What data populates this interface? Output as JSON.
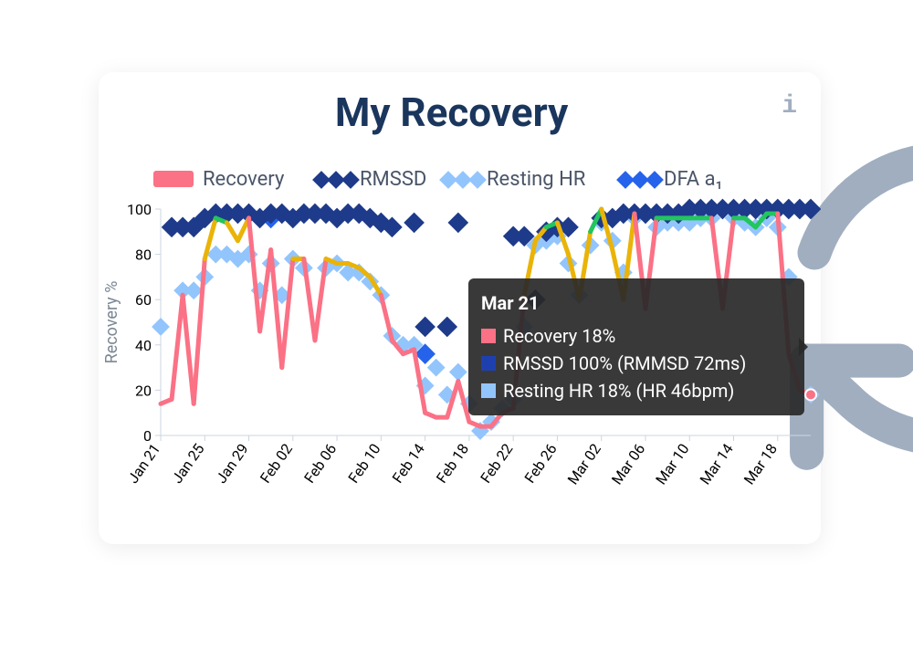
{
  "header": {
    "title": "My Recovery",
    "refresh_icon": "refresh-icon",
    "info_icon": "info-icon"
  },
  "legend": [
    {
      "key": "recovery",
      "label": "Recovery",
      "swatch": "#fb7185",
      "style": "fill"
    },
    {
      "key": "rmssd",
      "label": "RMSSD",
      "swatch": "#1e3a8a",
      "style": "diamond"
    },
    {
      "key": "rhr",
      "label": "Resting HR",
      "swatch": "#93c5fd",
      "style": "diamond"
    },
    {
      "key": "dfa",
      "label": "DFA a₁",
      "swatch": "#2563eb",
      "style": "diamond"
    }
  ],
  "tooltip": {
    "visible": true,
    "title": "Mar 21",
    "lines": [
      {
        "swatch": "rec",
        "text": "Recovery 18%"
      },
      {
        "swatch": "rms",
        "text": "RMSSD 100% (RMMSD 72ms)"
      },
      {
        "swatch": "rhr",
        "text": "Resting HR 18% (HR 46bpm)"
      }
    ]
  },
  "chart_data": {
    "type": "line",
    "title": "My Recovery",
    "xlabel": "",
    "ylabel": "Recovery %",
    "ylim": [
      0,
      100
    ],
    "x_dates": [
      "Jan 21",
      "Jan 22",
      "Jan 23",
      "Jan 24",
      "Jan 25",
      "Jan 26",
      "Jan 27",
      "Jan 28",
      "Jan 29",
      "Jan 30",
      "Jan 31",
      "Feb 01",
      "Feb 02",
      "Feb 03",
      "Feb 04",
      "Feb 05",
      "Feb 06",
      "Feb 07",
      "Feb 08",
      "Feb 09",
      "Feb 10",
      "Feb 11",
      "Feb 12",
      "Feb 13",
      "Feb 14",
      "Feb 15",
      "Feb 16",
      "Feb 17",
      "Feb 18",
      "Feb 19",
      "Feb 20",
      "Feb 21",
      "Feb 22",
      "Feb 23",
      "Feb 24",
      "Feb 25",
      "Feb 26",
      "Feb 27",
      "Feb 28",
      "Mar 01",
      "Mar 02",
      "Mar 03",
      "Mar 04",
      "Mar 05",
      "Mar 06",
      "Mar 07",
      "Mar 08",
      "Mar 09",
      "Mar 10",
      "Mar 11",
      "Mar 12",
      "Mar 13",
      "Mar 14",
      "Mar 15",
      "Mar 16",
      "Mar 17",
      "Mar 18",
      "Mar 19",
      "Mar 20",
      "Mar 21"
    ],
    "x_tick_labels": [
      "Jan 21",
      "Jan 25",
      "Jan 29",
      "Feb 02",
      "Feb 06",
      "Feb 10",
      "Feb 14",
      "Feb 18",
      "Feb 22",
      "Feb 26",
      "Mar 02",
      "Mar 06",
      "Mar 10",
      "Mar 14",
      "Mar 18"
    ],
    "series": [
      {
        "name": "Recovery",
        "style": "line-colored",
        "values": [
          14,
          16,
          62,
          14,
          78,
          96,
          94,
          86,
          96,
          46,
          82,
          30,
          78,
          78,
          42,
          78,
          76,
          76,
          74,
          70,
          62,
          42,
          36,
          38,
          10,
          8,
          8,
          24,
          6,
          4,
          4,
          10,
          12,
          62,
          86,
          92,
          94,
          80,
          60,
          90,
          100,
          82,
          60,
          98,
          56,
          96,
          96,
          96,
          96,
          96,
          96,
          56,
          96,
          96,
          92,
          98,
          98,
          36,
          20,
          18
        ]
      },
      {
        "name": "RMSSD",
        "style": "scatter-diamond",
        "color": "#1e3a8a",
        "values": [
          null,
          92,
          92,
          92,
          96,
          98,
          98,
          98,
          98,
          96,
          98,
          98,
          96,
          98,
          98,
          98,
          96,
          98,
          98,
          96,
          94,
          92,
          null,
          94,
          48,
          null,
          48,
          94,
          null,
          null,
          null,
          null,
          88,
          88,
          60,
          90,
          92,
          92,
          null,
          null,
          96,
          96,
          98,
          98,
          98,
          98,
          98,
          98,
          100,
          100,
          100,
          100,
          100,
          100,
          100,
          100,
          100,
          100,
          100,
          100
        ]
      },
      {
        "name": "Resting HR",
        "style": "scatter-diamond",
        "color": "#93c5fd",
        "values": [
          48,
          null,
          64,
          64,
          70,
          80,
          80,
          78,
          80,
          64,
          76,
          62,
          78,
          74,
          null,
          74,
          76,
          72,
          72,
          68,
          62,
          44,
          40,
          40,
          22,
          30,
          18,
          28,
          14,
          2,
          6,
          12,
          16,
          48,
          84,
          86,
          88,
          76,
          62,
          84,
          94,
          86,
          72,
          96,
          null,
          92,
          94,
          94,
          94,
          96,
          96,
          null,
          96,
          94,
          92,
          96,
          92,
          70,
          null,
          18
        ]
      },
      {
        "name": "DFA a1",
        "style": "scatter-diamond",
        "color": "#2563eb",
        "values": [
          null,
          null,
          null,
          null,
          null,
          null,
          null,
          null,
          null,
          null,
          96,
          null,
          null,
          null,
          null,
          null,
          null,
          null,
          null,
          null,
          null,
          null,
          null,
          null,
          36,
          null,
          null,
          null,
          null,
          null,
          null,
          null,
          null,
          null,
          null,
          null,
          null,
          null,
          null,
          null,
          null,
          null,
          null,
          null,
          null,
          null,
          null,
          null,
          null,
          null,
          null,
          null,
          null,
          null,
          null,
          null,
          null,
          null,
          null,
          null
        ]
      }
    ],
    "highlight_point": {
      "series": "Recovery",
      "x": "Mar 21",
      "value": 18,
      "color": "#fb7185"
    },
    "legend_position": "top",
    "grid": false
  }
}
